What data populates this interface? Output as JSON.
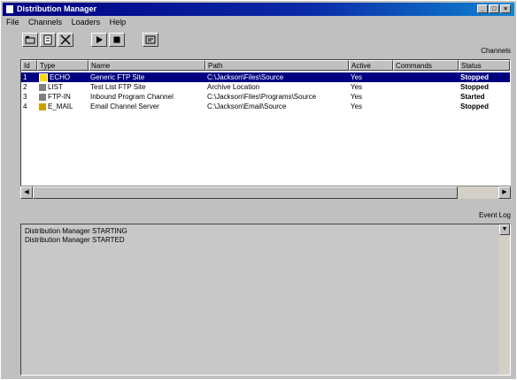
{
  "window": {
    "title": "Distribution Manager"
  },
  "titlebar_buttons": [
    "_",
    "□",
    "×"
  ],
  "menu": [
    "File",
    "Channels",
    "Loaders",
    "Help"
  ],
  "toolbar": {
    "buttons": [
      "open-icon",
      "properties-icon",
      "delete-icon",
      "play-icon",
      "stop-icon",
      "view-icon"
    ]
  },
  "channels_label": "Channels",
  "table": {
    "columns": [
      "Id",
      "Type",
      "Name",
      "Path",
      "Active",
      "Commands",
      "Status"
    ],
    "rows": [
      {
        "id": "1",
        "type": "ECHO",
        "name": "Generic FTP Site",
        "path": "C:\\Jackson\\Files\\Source",
        "active": "Yes",
        "commands": "",
        "status": "Stopped",
        "selected": true
      },
      {
        "id": "2",
        "type": "LIST",
        "name": "Test List FTP Site",
        "path": "Archive Location",
        "active": "Yes",
        "commands": "",
        "status": "Stopped",
        "selected": false
      },
      {
        "id": "3",
        "type": "FTP-IN",
        "name": "Inbound Program Channel",
        "path": "C:\\Jackson\\Files\\Programs\\Source",
        "active": "Yes",
        "commands": "",
        "status": "Started",
        "selected": false
      },
      {
        "id": "4",
        "type": "E_MAIL",
        "name": "Email Channel Server",
        "path": "C:\\Jackson\\Email\\Source",
        "active": "Yes",
        "commands": "",
        "status": "Stopped",
        "selected": false
      }
    ]
  },
  "log_label": "Event Log",
  "log": {
    "lines": [
      "Distribution Manager STARTING",
      "Distribution Manager STARTED"
    ]
  },
  "colors": {
    "selection": "#000080",
    "face": "#c0c0c0",
    "title_start": "#000080"
  }
}
